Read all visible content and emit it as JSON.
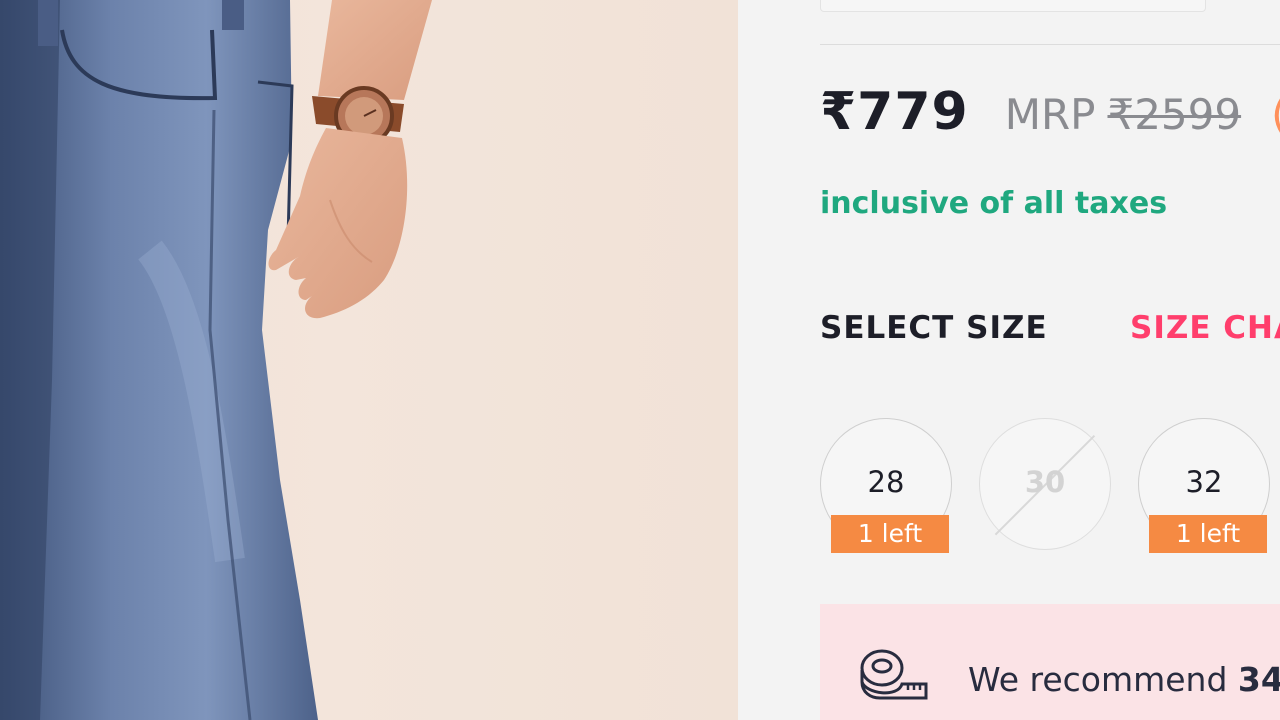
{
  "product": {
    "price": "₹779",
    "mrp_label": "MRP",
    "mrp_value": "₹2599",
    "discount_fragment": "(",
    "tax_note": "inclusive of all taxes"
  },
  "size_section": {
    "title": "SELECT SIZE",
    "chart_link": "SIZE CHA",
    "sizes": [
      {
        "label": "28",
        "stock": "1 left",
        "available": true
      },
      {
        "label": "30",
        "stock": "",
        "available": false
      },
      {
        "label": "32",
        "stock": "1 left",
        "available": true
      }
    ]
  },
  "recommendation": {
    "text": "We recommend ",
    "size": "34"
  },
  "colors": {
    "price": "#1d1e28",
    "tax": "#1fa87f",
    "accent": "#ff3e6c",
    "stock_badge": "#f58a43",
    "recommend_bg": "#fbe3e6"
  },
  "icons": {
    "recommend": "measuring-tape-icon"
  }
}
